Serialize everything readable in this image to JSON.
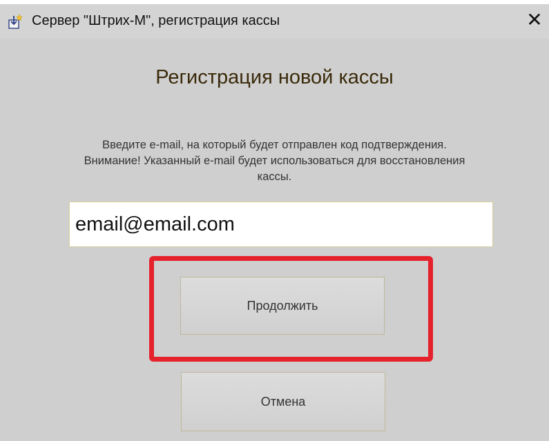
{
  "window": {
    "title": "Сервер \"Штрих-М\", регистрация кассы",
    "close_symbol": "✕",
    "icon": "app-registration-icon"
  },
  "dialog": {
    "heading": "Регистрация новой кассы",
    "instructions": "Введите e-mail, на который будет отправлен код подтверждения. Внимание! Указанный e-mail будет использоваться для восстановления кассы.",
    "email_value": "email@email.com",
    "continue_label": "Продолжить",
    "cancel_label": "Отмена"
  },
  "colors": {
    "highlight": "#e5222b",
    "background": "#cfcfcf",
    "heading": "#3a2a0a"
  }
}
